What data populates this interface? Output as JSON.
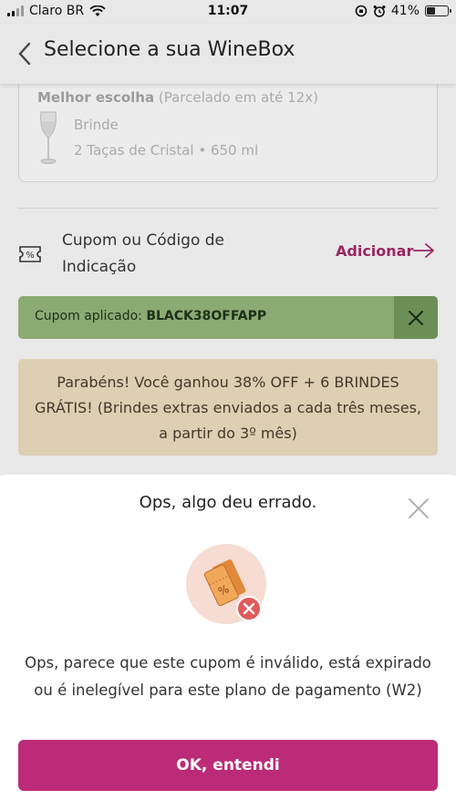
{
  "status_bar": {
    "carrier": "Claro BR",
    "time": "11:07",
    "battery_percent": "41%",
    "battery_level": 0.41
  },
  "header": {
    "title": "Selecione a sua WineBox"
  },
  "plan_card": {
    "label_bold": "Melhor escolha",
    "label_note": "(Parcelado em até 12x)",
    "gift_title": "Brinde",
    "gift_desc": "2 Taças de Cristal • 650 ml"
  },
  "coupon": {
    "label": "Cupom ou Código de Indicação",
    "add_label": "Adicionar"
  },
  "applied": {
    "label": "Cupom aplicado:",
    "code": "BLACK38OFFAPP"
  },
  "congrats": {
    "text": "Parabéns! Você ganhou 38% OFF + 6 BRINDES GRÁTIS! (Brindes extras enviados a cada três meses, a partir do 3º mês)"
  },
  "sheet": {
    "title": "Ops, algo deu errado.",
    "message": "Ops, parece que este cupom é inválido, está expirado ou é inelegível para este plano de pagamento (W2)",
    "button_label": "OK, entendi"
  },
  "icons": {
    "back": "chevron-left-icon",
    "coupon": "ticket-percent-icon",
    "arrow": "arrow-right-icon",
    "close": "close-icon",
    "error": "coupon-error-icon",
    "glass": "wine-glass-icon"
  },
  "colors": {
    "accent": "#bc2b77",
    "link": "#9b2660",
    "applied_bg": "#8aab74",
    "congrats_bg": "#dccfb3"
  }
}
